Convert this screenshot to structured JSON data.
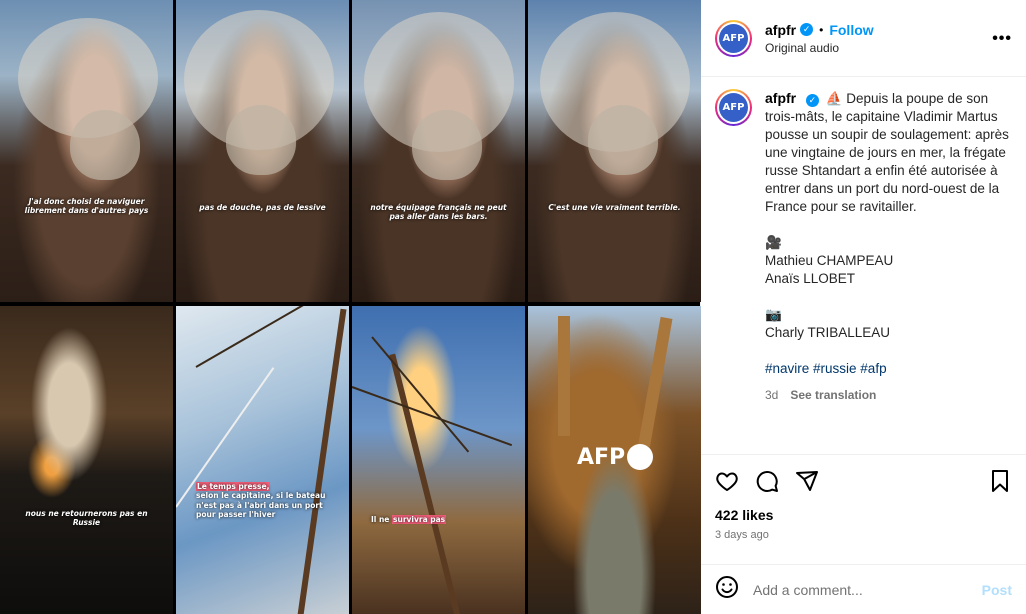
{
  "media": {
    "captions": [
      "J'ai donc choisi de naviguer librement dans d'autres pays",
      "pas de douche, pas de lessive",
      "notre équipage français ne peut pas aller dans les bars.",
      "C'est une vie vraiment terrible.",
      "nous ne retournerons pas en Russie"
    ],
    "caption6_pre": "Le temps presse,",
    "caption6_rest": "selon le capitaine, si le bateau n'est pas à l'abri dans un port pour passer l'hiver",
    "caption7_pre": "Il ne",
    "caption7_hl": "survivra pas",
    "logo_text": "AFP"
  },
  "header": {
    "avatar_text": "AFP",
    "username": "afpfr",
    "verified_mark": "✓",
    "dot": "•",
    "follow": "Follow",
    "subtitle": "Original audio",
    "more": "•••"
  },
  "caption": {
    "avatar_text": "AFP",
    "username": "afpfr",
    "verified_mark": "✓",
    "intro_emoji": "⛵",
    "text": "Depuis la poupe de son trois-mâts, le capitaine Vladimir Martus pousse un soupir de soulagement: après une vingtaine de jours en mer, la frégate russe Shtandart a enfin été autorisée à entrer dans un port du nord-ouest de la France pour se ravitailler.",
    "camera_emoji": "🎥",
    "credit1": "Mathieu CHAMPEAU",
    "credit2": "Anaïs LLOBET",
    "photo_emoji": "📷",
    "credit3": "Charly TRIBALLEAU",
    "hashtags": "#navire #russie #afp",
    "age": "3d",
    "see_translation": "See translation"
  },
  "actions": {
    "likes": "422 likes",
    "date": "3 days ago"
  },
  "comment": {
    "placeholder": "Add a comment...",
    "post": "Post"
  }
}
